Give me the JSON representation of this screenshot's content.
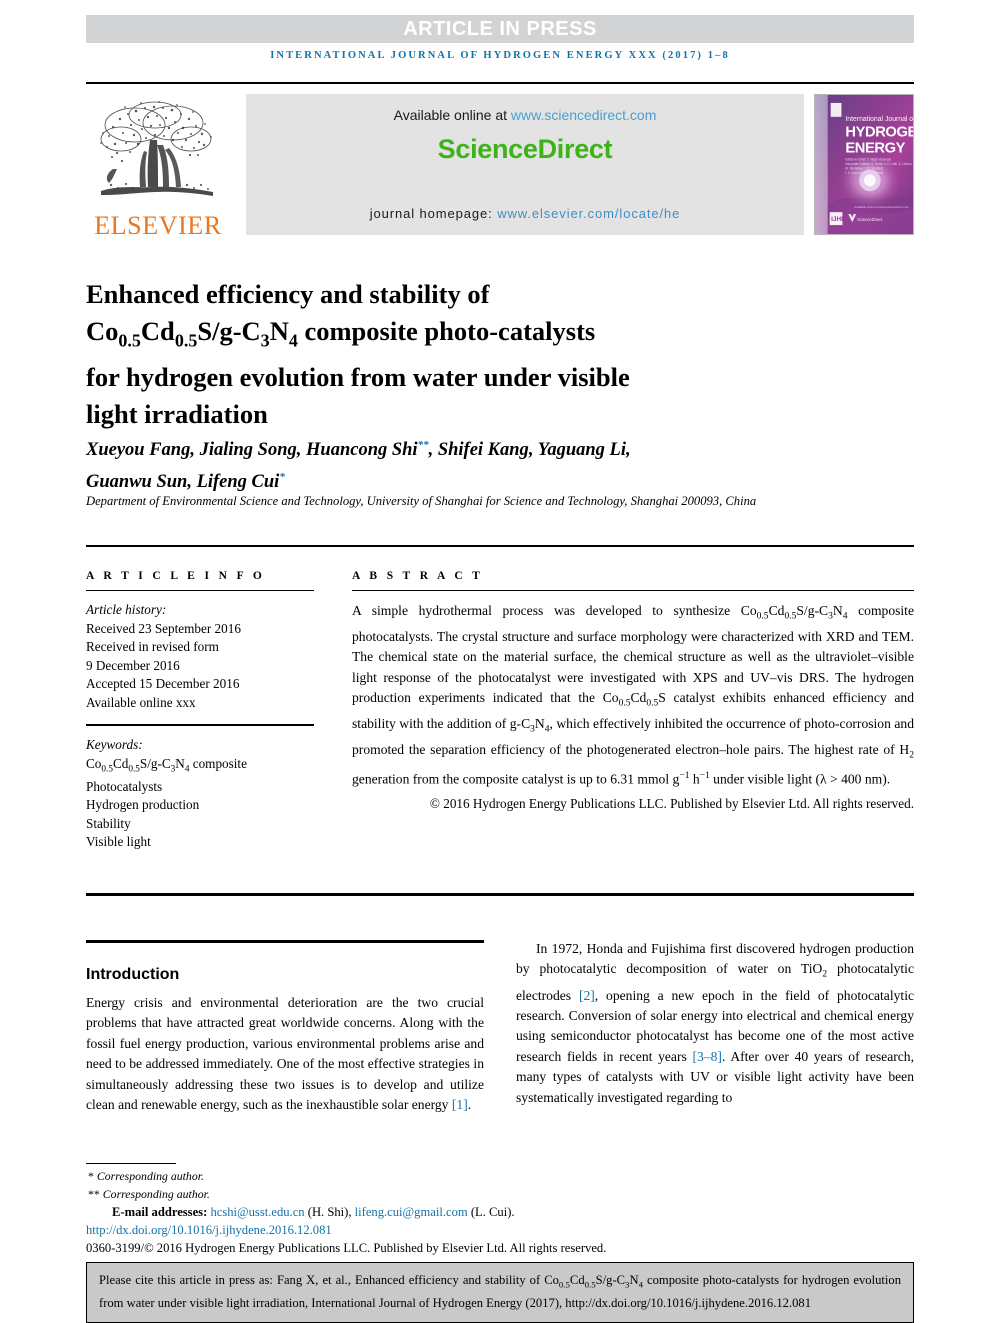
{
  "header": {
    "article_in_press": "ARTICLE IN PRESS",
    "journal_line": "INTERNATIONAL JOURNAL OF HYDROGEN ENERGY XXX (2017) 1–8",
    "accent_color": "#1273a8",
    "aip_bar_color": "#d2d3d5"
  },
  "masthead": {
    "publisher_name": "ELSEVIER",
    "publisher_color": "#e87722",
    "available_prefix": "Available online at ",
    "available_link": "www.sciencedirect.com",
    "sciencedirect_logo": "ScienceDirect",
    "sciencedirect_color": "#3db318",
    "homepage_prefix": "journal homepage: ",
    "homepage_link": "www.elsevier.com/locate/he",
    "cover": {
      "line1": "International Journal of",
      "line2": "HYDROGEN",
      "line3": "ENERGY",
      "editors_block": "Editor-in-Chief: T. Nejat Veziroglu\nAssociate Editors: S. Dutta, D.O. Hall, A. Linkov,\nM. Momirlan, J.W. Sheffield,\nI. e. Iyuk and E.A. Ticianelli",
      "footer_mark": "ScienceDirect"
    }
  },
  "article": {
    "title_lines": [
      "Enhanced efficiency and stability of",
      "Co0.5Cd0.5S/g-C3N4 composite photo-catalysts",
      "for hydrogen evolution from water under visible",
      "light irradiation"
    ],
    "authors": "Xueyou Fang, Jialing Song, Huancong Shi**, Shifei Kang, Yaguang Li, Guanwu Sun, Lifeng Cui*",
    "affiliation": "Department of Environmental Science and Technology, University of Shanghai for Science and Technology, Shanghai 200093, China"
  },
  "article_info": {
    "heading": "A R T I C L E   I N F O",
    "history_label": "Article history:",
    "received": "Received 23 September 2016",
    "revised_label": "Received in revised form",
    "revised_date": "9 December 2016",
    "accepted": "Accepted 15 December 2016",
    "available_online": "Available online xxx",
    "keywords_label": "Keywords:",
    "keywords": [
      "Co0.5Cd0.5S/g-C3N4 composite",
      "Photocatalysts",
      "Hydrogen production",
      "Stability",
      "Visible light"
    ]
  },
  "abstract": {
    "heading": "A B S T R A C T",
    "copyright": "© 2016 Hydrogen Energy Publications LLC. Published by Elsevier Ltd. All rights reserved."
  },
  "introduction": {
    "heading": "Introduction",
    "left_paragraph": "Energy crisis and environmental deterioration are the two crucial problems that have attracted great worldwide concerns. Along with the fossil fuel energy production, various environmental problems arise and need to be addressed immediately. One of the most effective strategies in simultaneously addressing these two issues is to develop and utilize clean and renewable energy, such as the inexhaustible solar energy [1]."
  },
  "footnotes": {
    "corresponding_1": "Corresponding author.",
    "corresponding_2": "Corresponding author.",
    "email_label": "E-mail addresses:",
    "email_1": "hcshi@usst.edu.cn",
    "email_1_owner": "(H. Shi),",
    "email_2": "lifeng.cui@gmail.com",
    "email_2_owner": "(L. Cui).",
    "doi": "http://dx.doi.org/10.1016/j.ijhydene.2016.12.081",
    "issn_line": "0360-3199/© 2016 Hydrogen Energy Publications LLC. Published by Elsevier Ltd. All rights reserved."
  },
  "citation_box": {
    "background": "#c9c9c9"
  }
}
